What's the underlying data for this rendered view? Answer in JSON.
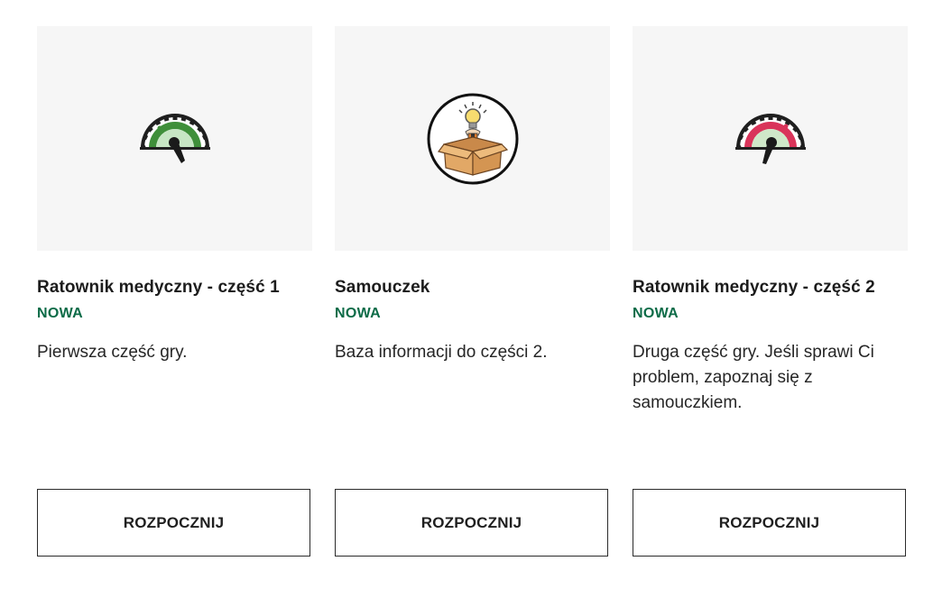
{
  "cards": [
    {
      "title": "Ratownik medyczny - część 1",
      "badge": "NOWA",
      "description": "Pierwsza część gry.",
      "button": "ROZPOCZNIJ",
      "icon": "gauge-green-icon",
      "accent": "#3f8f3a"
    },
    {
      "title": "Samouczek",
      "badge": "NOWA",
      "description": "Baza informacji do części 2.",
      "button": "ROZPOCZNIJ",
      "icon": "lightbulb-box-icon",
      "accent": "#d9a35c"
    },
    {
      "title": "Ratownik medyczny - część 2",
      "badge": "NOWA",
      "description": "Druga część gry. Jeśli sprawi Ci problem, zapoznaj się z samouczkiem.",
      "button": "ROZPOCZNIJ",
      "icon": "gauge-red-icon",
      "accent": "#d9345a"
    }
  ],
  "colors": {
    "badge": "#0b6b47",
    "thumb_background": "#f6f6f6"
  }
}
